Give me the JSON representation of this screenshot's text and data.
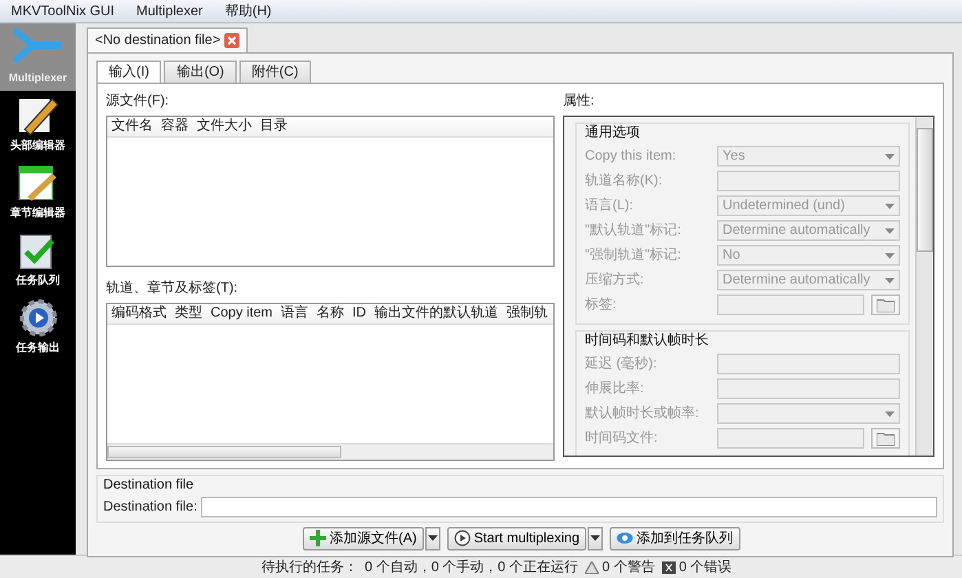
{
  "menu": [
    {
      "label": "MKVToolNix GUI"
    },
    {
      "label": "Multiplexer"
    },
    {
      "label": "帮助(H)"
    }
  ],
  "sidebar": {
    "items": [
      {
        "label": "Multiplexer",
        "kind": "multiplexer",
        "selected": true
      },
      {
        "label": "头部编辑器",
        "kind": "header",
        "selected": false
      },
      {
        "label": "章节编辑器",
        "kind": "chapter",
        "selected": false
      },
      {
        "label": "任务队列",
        "kind": "queue",
        "selected": false
      },
      {
        "label": "任务输出",
        "kind": "output",
        "selected": false
      }
    ]
  },
  "file_tabs": [
    {
      "label": "<No destination file>",
      "selected": true
    }
  ],
  "tabs": [
    {
      "label": "输入(I)",
      "selected": true
    },
    {
      "label": "输出(O)",
      "selected": false
    },
    {
      "label": "附件(C)",
      "selected": false
    }
  ],
  "source_files": {
    "label": "源文件(F):",
    "columns": [
      "文件名",
      "容器",
      "文件大小",
      "目录"
    ]
  },
  "tracks": {
    "label": "轨道、章节及标签(T):",
    "columns": [
      "编码格式",
      "类型",
      "Copy item",
      "语言",
      "名称",
      "ID",
      "输出文件的默认轨道",
      "强制轨"
    ]
  },
  "properties": {
    "label": "属性:",
    "disabled": true,
    "groups": [
      {
        "title": "通用选项",
        "rows": [
          {
            "label": "Copy this item:",
            "kind": "combo",
            "value": "Yes"
          },
          {
            "label": "轨道名称(K):",
            "kind": "input"
          },
          {
            "label": "语言(L):",
            "kind": "combo",
            "value": "Undetermined (und)"
          },
          {
            "label": "\"默认轨道\"标记:",
            "kind": "combo",
            "value": "Determine automatically"
          },
          {
            "label": "\"强制轨道\"标记:",
            "kind": "combo",
            "value": "No"
          },
          {
            "label": "压缩方式:",
            "kind": "combo",
            "value": "Determine automatically"
          },
          {
            "label": "标签:",
            "kind": "browse"
          }
        ]
      },
      {
        "title": "时间码和默认帧时长",
        "rows": [
          {
            "label": "延迟 (毫秒):",
            "kind": "input"
          },
          {
            "label": "伸展比率:",
            "kind": "input"
          },
          {
            "label": "默认帧时长或帧率:",
            "kind": "combo"
          },
          {
            "label": "时间码文件:",
            "kind": "browse"
          }
        ]
      }
    ]
  },
  "destination": {
    "group_title": "Destination file",
    "label": "Destination file:"
  },
  "buttons": [
    {
      "label": "添加源文件(A)",
      "kind": "add",
      "dropdown": true
    },
    {
      "label": "Start multiplexing",
      "kind": "start",
      "dropdown": true
    },
    {
      "label": "添加到任务队列",
      "kind": "queue",
      "dropdown": false
    }
  ],
  "status_bar": {
    "pending": "待执行的任务：",
    "counts": "0 个自动，0 个手动，0 个正在运行",
    "warnings": "0 个警告",
    "errors": "0 个错误"
  }
}
